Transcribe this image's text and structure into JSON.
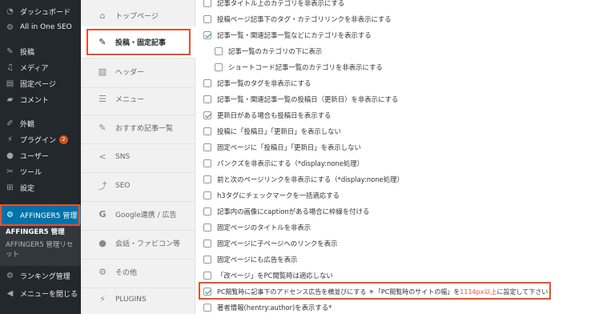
{
  "wp_menu": {
    "dashboard": "ダッシュボード",
    "allinone": "All in One SEO",
    "posts": "投稿",
    "media": "メディア",
    "pages": "固定ページ",
    "comments": "コメント",
    "appearance": "外観",
    "plugins": "プラグイン",
    "plugins_badge": "2",
    "users": "ユーザー",
    "tools": "ツール",
    "settings": "設定",
    "affinger": "AFFINGER5 管理",
    "sub_affinger": "AFFINGER5 管理",
    "sub_reset_1": "AFFINGER5 管理リセ",
    "sub_reset_2": "ット",
    "ranking": "ランキング管理",
    "collapse": "メニューを閉じる"
  },
  "tabs": [
    {
      "label": "トップページ",
      "icon": "home-icon"
    },
    {
      "label": "投稿・固定記事",
      "icon": "edit-icon"
    },
    {
      "label": "ヘッダー",
      "icon": "image-icon"
    },
    {
      "label": "メニュー",
      "icon": "menu-icon"
    },
    {
      "label": "おすすめ記事一覧",
      "icon": "edit-icon"
    },
    {
      "label": "SNS",
      "icon": "share-icon"
    },
    {
      "label": "SEO",
      "icon": "chart-icon"
    },
    {
      "label": "Google連携 / 広告",
      "icon": "google-icon"
    },
    {
      "label": "会話・ファビコン等",
      "icon": "comment-icon"
    },
    {
      "label": "その他",
      "icon": "gear-icon"
    },
    {
      "label": "PLUGINS",
      "icon": "plug-icon"
    }
  ],
  "options": [
    {
      "label": "記事タイトル上のカテゴリを非表示にする",
      "checked": false
    },
    {
      "label": "投稿ページ記事下のタグ・カテゴリリンクを非表示にする",
      "checked": false
    },
    {
      "label": "記事一覧・関連記事一覧などにカテゴリを表示する",
      "checked": true
    },
    {
      "label": "記事一覧のカテゴリの下に表示",
      "checked": false
    },
    {
      "label": "ショートコード記事一覧のカテゴリを非表示にする",
      "checked": false
    },
    {
      "label": "記事一覧のタグを非表示にする",
      "checked": false
    },
    {
      "label": "記事一覧・関連記事一覧の投稿日（更新日）を非表示にする",
      "checked": false
    },
    {
      "label": "更新日がある場合も投稿日を表示する",
      "checked": true
    },
    {
      "label": "投稿に「投稿日」「更新日」を表示しない",
      "checked": false
    },
    {
      "label": "固定ページに「投稿日」「更新日」を表示しない",
      "checked": false
    },
    {
      "label": "パンクズを非表示にする（*display:none処理）",
      "checked": false
    },
    {
      "label": "前と次のページリンクを非表示にする（*display:none処理）",
      "checked": false
    },
    {
      "label": "h3タグにチェックマークを一括適応する",
      "checked": false
    },
    {
      "label": "記事内の画像にcaptionがある場合に枠線を付ける",
      "checked": false
    },
    {
      "label": "固定ページのタイトルを非表示",
      "checked": false
    },
    {
      "label": "固定ページに子ページへのリンクを表示",
      "checked": false
    },
    {
      "label": "固定ページにも広告を表示",
      "checked": false
    },
    {
      "label": "「改ページ」をPC閲覧時は適応しない",
      "checked": false
    },
    {
      "label": "PC閲覧時に記事下のアドセンス広告を横並びにする ＊「PC閲覧時のサイトの幅」を",
      "label_red": "1114px以上",
      "label_end": "に設定して下さい",
      "checked": true
    },
    {
      "label": "著者情報(hentry:author)を表示する*",
      "checked": false
    }
  ],
  "colors": {
    "highlight": "#e8502a",
    "wp_blue": "#0073aa"
  }
}
